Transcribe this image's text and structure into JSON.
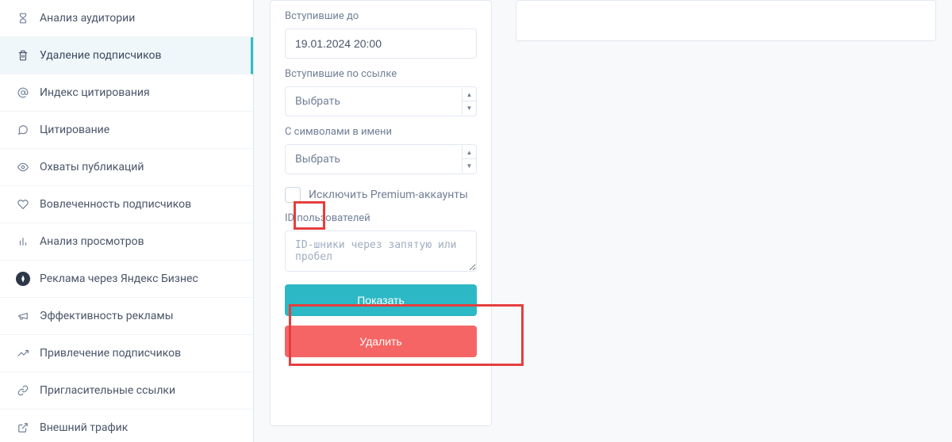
{
  "sidebar": {
    "items": [
      {
        "label": "Анализ аудитории",
        "icon": "hourglass-icon"
      },
      {
        "label": "Удаление подписчиков",
        "icon": "trash-icon",
        "active": true
      },
      {
        "label": "Индекс цитирования",
        "icon": "at-icon"
      },
      {
        "label": "Цитирование",
        "icon": "mention-icon"
      },
      {
        "label": "Охваты публикаций",
        "icon": "eye-icon"
      },
      {
        "label": "Вовлеченность подписчиков",
        "icon": "heart-icon"
      },
      {
        "label": "Анализ просмотров",
        "icon": "bar-chart-icon"
      },
      {
        "label": "Реклама через Яндекс Бизнес",
        "icon": "yandex-icon"
      },
      {
        "label": "Эффективность рекламы",
        "icon": "megaphone-icon"
      },
      {
        "label": "Привлечение подписчиков",
        "icon": "trend-icon"
      },
      {
        "label": "Пригласительные ссылки",
        "icon": "link-icon"
      },
      {
        "label": "Внешний трафик",
        "icon": "external-icon"
      }
    ]
  },
  "form": {
    "joined_before": {
      "label": "Вступившие до",
      "value": "19.01.2024 20:00"
    },
    "joined_via_link": {
      "label": "Вступившие по ссылке",
      "placeholder": "Выбрать"
    },
    "symbols_in_name": {
      "label": "С символами в имени",
      "placeholder": "Выбрать"
    },
    "exclude_premium": {
      "label": "Исключить Premium-аккаунты"
    },
    "user_ids": {
      "label": "ID пользователей",
      "placeholder": "ID-шники через запятую или пробел"
    },
    "show_button": "Показать",
    "delete_button": "Удалить"
  },
  "colors": {
    "accent": "#2db8c5",
    "danger": "#f56565",
    "highlight": "#e53e3e"
  }
}
